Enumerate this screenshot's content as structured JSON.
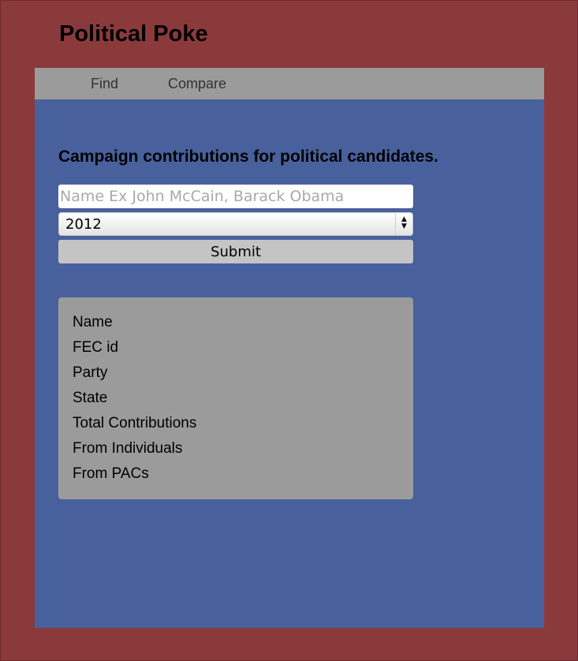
{
  "header": {
    "title": "Political Poke"
  },
  "nav": {
    "find_label": "Find",
    "compare_label": "Compare"
  },
  "main": {
    "heading": "Campaign contributions for political candidates.",
    "search": {
      "value": "",
      "placeholder": "Name Ex John McCain, Barack Obama"
    },
    "year_select": {
      "selected": "2012"
    },
    "submit_label": "Submit",
    "info_fields": [
      "Name",
      "FEC id",
      "Party",
      "State",
      "Total Contributions",
      "From Individuals",
      "From PACs"
    ]
  },
  "colors": {
    "frame_bg": "#8b3a3c",
    "nav_bg": "#9b9b9b",
    "main_bg": "#48619c",
    "panel_bg": "#9b9b9b"
  },
  "icons": {
    "select_arrows": "up-down-arrows-icon"
  }
}
